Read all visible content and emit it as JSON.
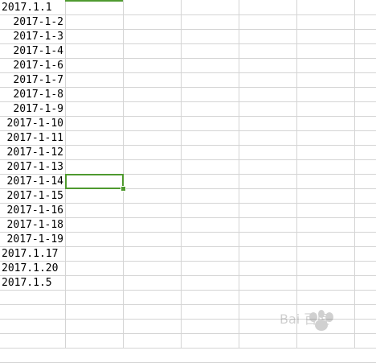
{
  "sheet": {
    "selected_cell_column_index": 1,
    "selected_cell_row_index": 12,
    "accent_color": "#4f9a2f",
    "gridline_color": "#d4d4d4"
  },
  "column_a": [
    {
      "text": "2017.1.1",
      "align": "left"
    },
    {
      "text": "2017-1-2",
      "align": "right"
    },
    {
      "text": "2017-1-3",
      "align": "right"
    },
    {
      "text": "2017-1-4",
      "align": "right"
    },
    {
      "text": "2017-1-6",
      "align": "right"
    },
    {
      "text": "2017-1-7",
      "align": "right"
    },
    {
      "text": "2017-1-8",
      "align": "right"
    },
    {
      "text": "2017-1-9",
      "align": "right"
    },
    {
      "text": "2017-1-10",
      "align": "right"
    },
    {
      "text": "2017-1-11",
      "align": "right"
    },
    {
      "text": "2017-1-12",
      "align": "right"
    },
    {
      "text": "2017-1-13",
      "align": "right"
    },
    {
      "text": "2017-1-14",
      "align": "right"
    },
    {
      "text": "2017-1-15",
      "align": "right"
    },
    {
      "text": "2017-1-16",
      "align": "right"
    },
    {
      "text": "2017-1-18",
      "align": "right"
    },
    {
      "text": "2017-1-19",
      "align": "right"
    },
    {
      "text": "2017.1.17",
      "align": "left"
    },
    {
      "text": "2017.1.20",
      "align": "left"
    },
    {
      "text": "2017.1.5",
      "align": "left"
    }
  ],
  "watermark": {
    "icon": "baidu-paw-icon",
    "text": "Bai 百度"
  }
}
